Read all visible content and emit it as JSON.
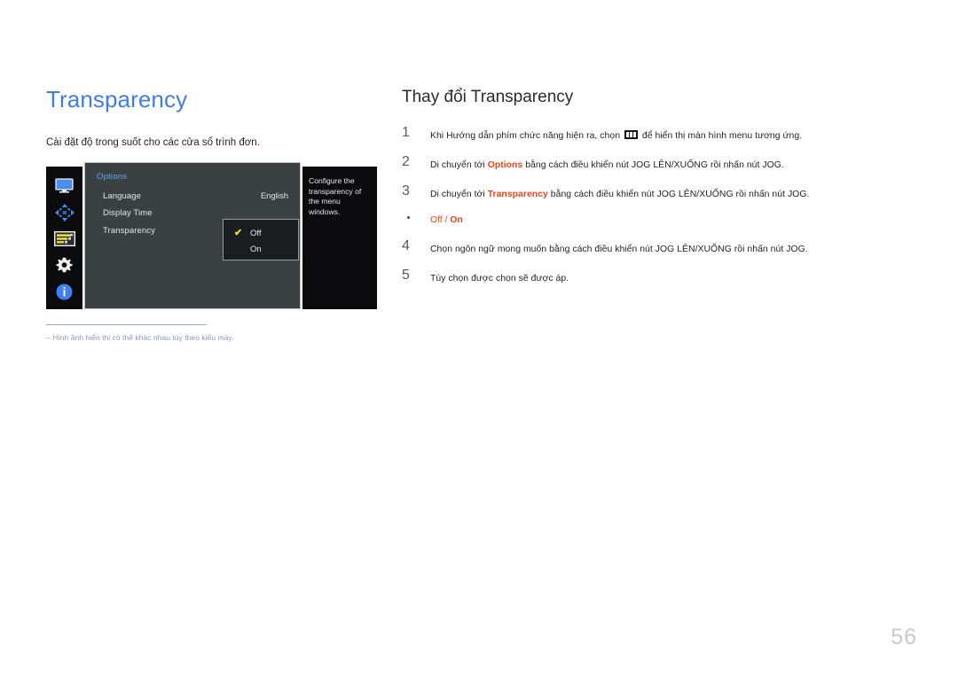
{
  "page": {
    "title": "Transparency",
    "description": "Cài đặt độ trong suốt cho các cửa sổ trình đơn.",
    "number": "56",
    "title_color": "#3e7fe0",
    "accent_color": "#e8431d"
  },
  "osd": {
    "menu_title": "Options",
    "rows": [
      {
        "label": "Language",
        "value": "English"
      },
      {
        "label": "Display Time",
        "value": ""
      },
      {
        "label": "Transparency",
        "value": ""
      }
    ],
    "dropdown": {
      "options": [
        "Off",
        "On"
      ],
      "selected": "Off",
      "check_glyph": "✔"
    },
    "help_text": "Configure the transparency of the menu windows.",
    "icons": [
      "monitor-icon",
      "directional-pad-icon",
      "sliders-icon",
      "gear-icon",
      "info-icon"
    ]
  },
  "footnote": {
    "text": "‒  Hình ảnh hiển thị có thể khác nhau tùy theo kiểu máy."
  },
  "instructions": {
    "title": "Thay đổi Transparency",
    "steps": [
      {
        "num": "1",
        "pre": "Khi Hướng dẫn phím chức năng hiện ra, chọn ",
        "glyph": "menu-icon",
        "post": " để hiển thị màn hình menu tương ứng."
      },
      {
        "num": "2",
        "pre": "Di chuyển tới ",
        "highlight": "Options",
        "post": " bằng cách điều khiển nút JOG LÊN/XUỐNG rồi nhấn nút JOG."
      },
      {
        "num": "3",
        "pre": "Di chuyển tới ",
        "highlight": "Transparency",
        "post": " bằng cách điều khiển nút JOG LÊN/XUỐNG rồi nhấn nút JOG."
      }
    ],
    "bullet": {
      "option_off": "Off",
      "separator": " / ",
      "option_on": "On"
    },
    "steps_after": [
      {
        "num": "4",
        "text": "Chọn ngôn ngữ mong muốn bằng cách điều khiển nút JOG LÊN/XUỐNG rồi nhấn nút JOG."
      },
      {
        "num": "5",
        "text": "Tùy chọn được chọn sẽ được áp."
      }
    ]
  }
}
